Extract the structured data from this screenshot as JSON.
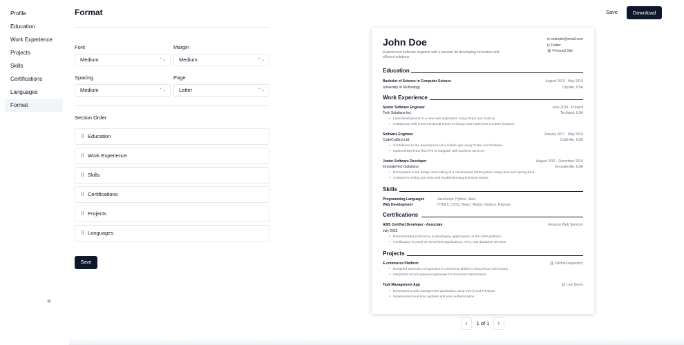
{
  "sidebar": {
    "items": [
      "Profile",
      "Education",
      "Work Experience",
      "Projects",
      "Skills",
      "Certifications",
      "Languages",
      "Format"
    ],
    "active": "Format",
    "collapse_icon": "«"
  },
  "form": {
    "title": "Format",
    "font_label": "Font",
    "font_value": "Medium",
    "margin_label": "Margin",
    "margin_value": "Medium",
    "spacing_label": "Spacing",
    "spacing_value": "Medium",
    "page_label": "Page",
    "page_value": "Letter",
    "section_order_title": "Section Order",
    "section_order": [
      "Education",
      "Work Experience",
      "Skills",
      "Certifications",
      "Projects",
      "Languages"
    ],
    "save_label": "Save"
  },
  "topbar": {
    "save_label": "Save",
    "download_label": "Download"
  },
  "resume": {
    "name": "John Doe",
    "summary": "Experienced software engineer with a passion for developing innovative and efficient solutions.",
    "contact": {
      "email": "example@email.com",
      "twitter": "Twitter",
      "site": "Personal Site"
    },
    "education": {
      "title": "Education",
      "degree": "Bachelor of Science in Computer Science",
      "dates": "August 2015 - May 2019",
      "school": "University of Technology",
      "location": "Cityville, USA"
    },
    "work": {
      "title": "Work Experience",
      "jobs": [
        {
          "role": "Senior Software Engineer",
          "dates": "June 2019 - Present",
          "company": "Tech Solutions Inc.",
          "location": "Techland, USA",
          "bullets": [
            "Lead development of a new web application using React and Node.js.",
            "Collaborate with cross-functional teams to design and implement complex features."
          ]
        },
        {
          "role": "Software Engineer",
          "dates": "January 2017 - May 2019",
          "company": "CodeCrafters Ltd.",
          "location": "Codeville, USA",
          "bullets": [
            "Contributed to the development of a mobile app using Flutter and Firebase.",
            "Implemented RESTful APIs to integrate with backend services."
          ]
        },
        {
          "role": "Junior Software Developer",
          "dates": "August 2016 - December 2016",
          "company": "InnovateTech Solutions",
          "location": "Innovateville, USA",
          "bullets": [
            "Participated in the design and coding of a cloud-based CRM system using Java and Spring Boot.",
            "Assisted in writing unit tests and troubleshooting technical issues."
          ]
        }
      ]
    },
    "skills": {
      "title": "Skills",
      "rows": [
        {
          "name": "Programming Languages",
          "value": "JavaScript, Python, Java"
        },
        {
          "name": "Web Development",
          "value": "HTML5, CSS3, React, Redux, Node.js, Express"
        }
      ]
    },
    "certifications": {
      "title": "Certifications",
      "name": "AWS Certified Developer - Associate",
      "issuer": "Amazon Web Services",
      "date": "July 2022",
      "bullets": [
        "Demonstrated proficiency in developing applications on the AWS platform.",
        "Certification focused on serverless applications, APIs, and database services."
      ]
    },
    "projects": {
      "title": "Projects",
      "items": [
        {
          "name": "E-commerce Platform",
          "link": "GitHub Repository",
          "bullets": [
            "Designed and built a responsive e-commerce platform using React and Redux.",
            "Integrated secure payment gateways for seamless transactions."
          ]
        },
        {
          "name": "Task Management App",
          "link": "Live Demo",
          "bullets": [
            "Developed a task management application using Vue.js and Firebase.",
            "Implemented real-time updates and user authentication."
          ]
        }
      ]
    }
  },
  "pager": {
    "text": "1 of 1",
    "prev": "‹",
    "next": "›"
  }
}
